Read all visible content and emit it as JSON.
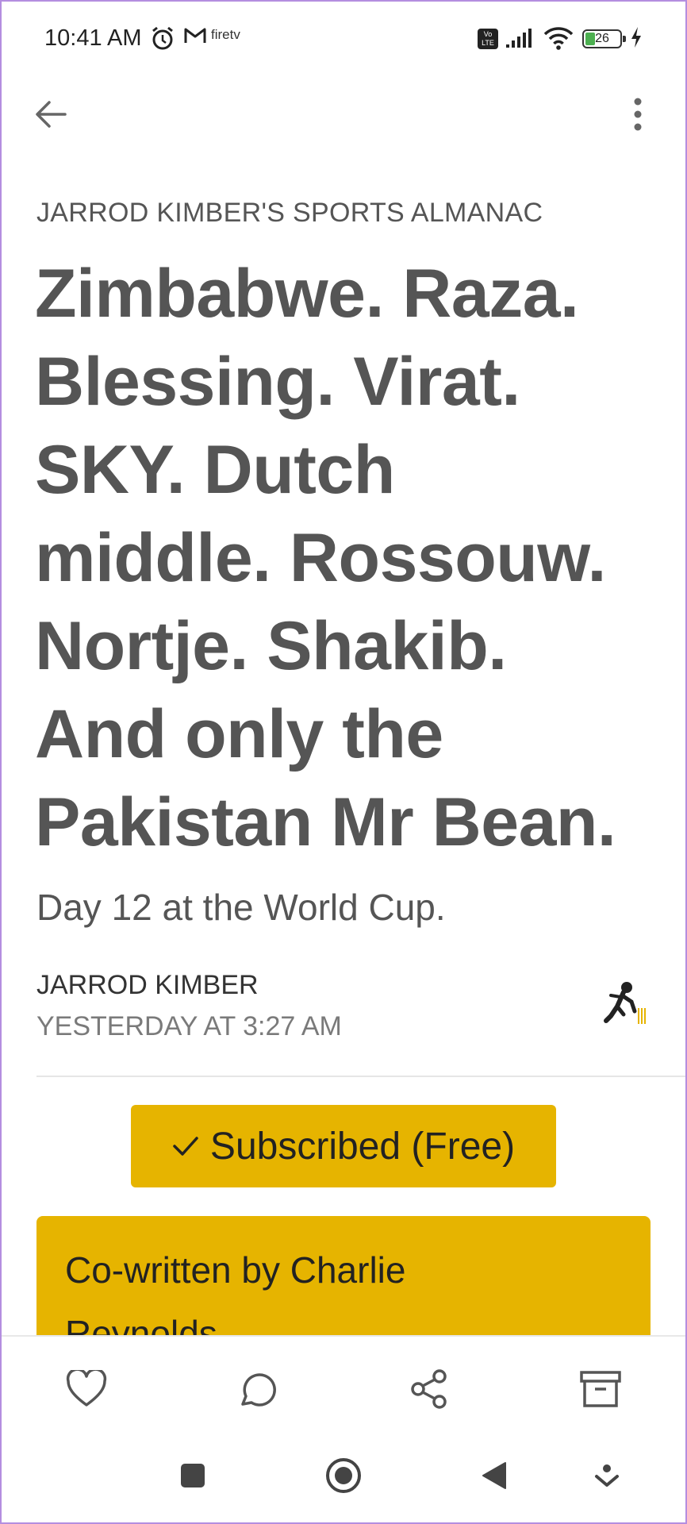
{
  "status_bar": {
    "time": "10:41 AM",
    "fire_tv_label": "firetv",
    "volte_label": "Vo LTE",
    "battery_level": "26"
  },
  "article": {
    "publication": "JARROD KIMBER'S SPORTS ALMANAC",
    "headline_lines": [
      "Zimbabwe. Raza.",
      "Blessing. Virat.",
      "SKY. Dutch",
      "middle. Rossouw.",
      "Nortje. Shakib.",
      "And only the",
      "Pakistan Mr Bean."
    ],
    "subtitle": "Day 12 at the World Cup.",
    "author": "JARROD KIMBER",
    "timestamp": "YESTERDAY AT 3:27 AM"
  },
  "subscribe": {
    "label": "Subscribed (Free)",
    "check_icon": "check-icon"
  },
  "callout": {
    "lines": [
      "Co-written by Charlie",
      "Reynolds"
    ]
  },
  "actions": {
    "icons": [
      "heart-icon",
      "comment-icon",
      "share-icon",
      "archive-icon"
    ]
  },
  "nav": {
    "icons": [
      "recents-square-icon",
      "home-circle-icon",
      "back-triangle-icon",
      "dropdown-icon"
    ]
  },
  "colors": {
    "accent": "#e6b400",
    "text": "#555555",
    "border": "#b48ee0"
  }
}
